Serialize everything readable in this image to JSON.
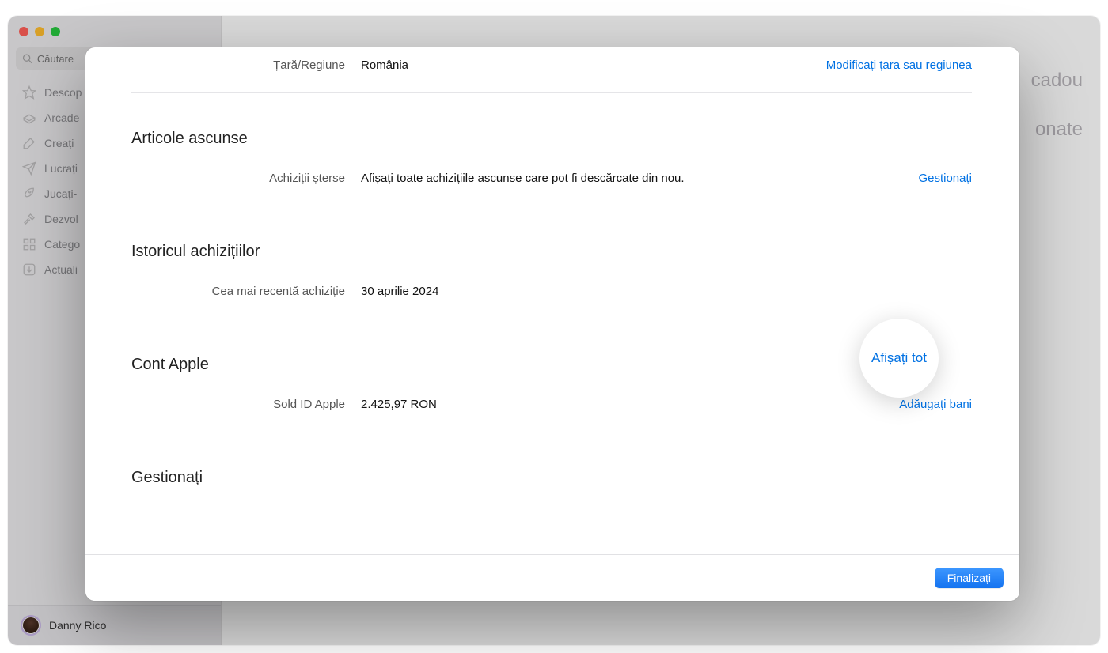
{
  "search": {
    "placeholder": "Căutare"
  },
  "sidebar": {
    "items": [
      {
        "label": "Descop"
      },
      {
        "label": "Arcade"
      },
      {
        "label": "Creați"
      },
      {
        "label": "Lucrați"
      },
      {
        "label": "Jucați-"
      },
      {
        "label": "Dezvol"
      },
      {
        "label": "Catego"
      },
      {
        "label": "Actuali"
      }
    ]
  },
  "user": {
    "name": "Danny Rico"
  },
  "bg": {
    "right1": "cadou",
    "right2": "onate"
  },
  "modal": {
    "country": {
      "label": "Țară/Regiune",
      "value": "România",
      "action": "Modificați țara sau regiunea"
    },
    "hidden": {
      "title": "Articole ascunse",
      "label": "Achiziții șterse",
      "value": "Afișați toate achizițiile ascunse care pot fi descărcate din nou.",
      "action": "Gestionați"
    },
    "history": {
      "title": "Istoricul achizițiilor",
      "label": "Cea mai recentă achiziție",
      "value": "30 aprilie 2024",
      "action": "Afișați tot"
    },
    "account": {
      "title": "Cont Apple",
      "label": "Sold ID Apple",
      "value": "2.425,97 RON",
      "action": "Adăugați bani"
    },
    "manage": {
      "title": "Gestionați"
    },
    "footer": {
      "done": "Finalizați"
    }
  }
}
